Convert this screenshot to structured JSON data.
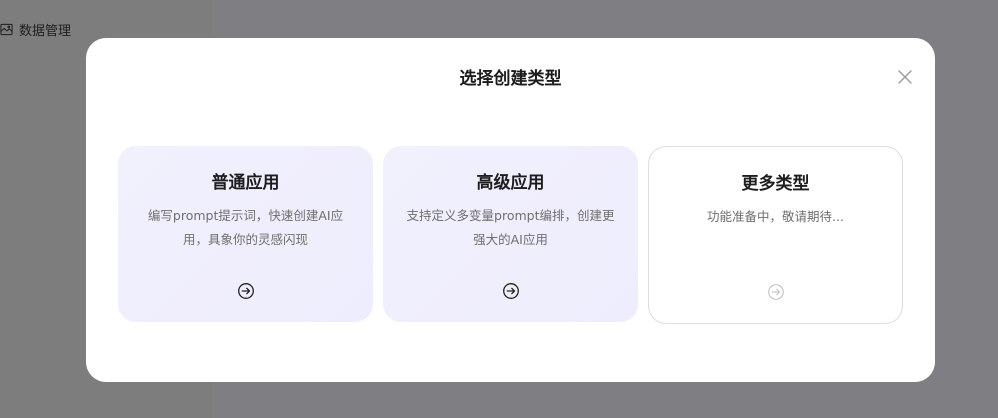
{
  "background": {
    "nav_item_label": "数据管理"
  },
  "modal": {
    "title": "选择创建类型",
    "cards": [
      {
        "title": "普通应用",
        "description": "编写prompt提示词，快速创建AI应用，具象你的灵感闪现",
        "enabled": true
      },
      {
        "title": "高级应用",
        "description": "支持定义多变量prompt编排，创建更强大的AI应用",
        "enabled": true
      },
      {
        "title": "更多类型",
        "description": "功能准备中，敬请期待...",
        "enabled": false
      }
    ]
  },
  "colors": {
    "overlay": "#7e7d81",
    "card_bg": "#efeefd",
    "arrow_active": "#222222",
    "arrow_disabled": "#c8c8c8"
  },
  "icons": {
    "nav": "database-icon",
    "close": "close-icon",
    "card_action": "arrow-right-circle-icon"
  }
}
